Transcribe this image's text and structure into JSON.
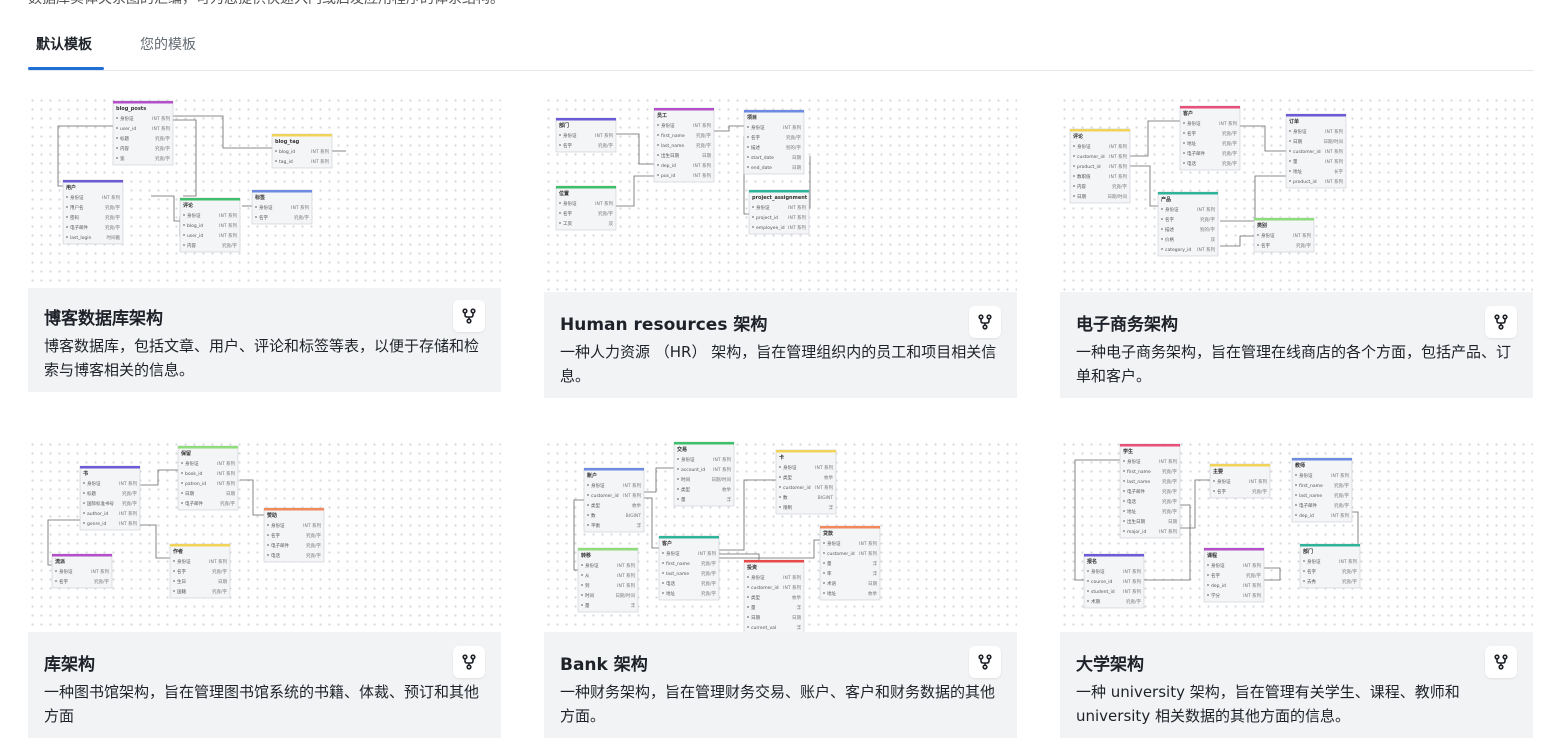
{
  "header": {
    "description": "数据库实体关系图的汇编，可为您提供快速入门或启发应用程序的体系结构。"
  },
  "tabs": [
    {
      "label": "默认模板",
      "active": true
    },
    {
      "label": "您的模板",
      "active": false
    }
  ],
  "templates": [
    {
      "title": "博客数据库架构",
      "description": "博客数据库，包括文章、用户、评论和标签等表，以便于存储和检索与博客相关的信息。",
      "tables": [
        {
          "name": "blog_posts",
          "color": "#b54fc9",
          "rows": [
            [
              "身份证",
              "INT 系列"
            ],
            [
              "user_id",
              "INT 系列"
            ],
            [
              "标题",
              "究竟/字"
            ],
            [
              "内容",
              "究竟/字"
            ],
            [
              "宽",
              "究竟/字"
            ]
          ]
        },
        {
          "name": "blog_tag",
          "color": "#f2d35a",
          "rows": [
            [
              "blog_id",
              "INT 系列"
            ],
            [
              "tag_id",
              "INT 系列"
            ]
          ]
        },
        {
          "name": "用户",
          "color": "#6b5bd6",
          "rows": [
            [
              "身份证",
              "INT 系列"
            ],
            [
              "用户名",
              "究竟/字"
            ],
            [
              "密码",
              "究竟/字"
            ],
            [
              "电子邮件",
              "究竟/字"
            ],
            [
              "last_login",
              "时间戳"
            ]
          ]
        },
        {
          "name": "评论",
          "color": "#3fbf6b",
          "rows": [
            [
              "身份证",
              "INT 系列"
            ],
            [
              "blog_id",
              "INT 系列"
            ],
            [
              "user_id",
              "INT 系列"
            ],
            [
              "内容",
              "究竟/字"
            ]
          ]
        },
        {
          "name": "标签",
          "color": "#6d8be0",
          "rows": [
            [
              "身份证",
              "INT 系列"
            ],
            [
              "名字",
              "究竟/字"
            ]
          ]
        }
      ]
    },
    {
      "title": "Human resources 架构",
      "description": "一种人力资源 （HR） 架构，旨在管理组织内的员工和项目相关信息。",
      "tables": [
        {
          "name": "部门",
          "color": "#6b5bd6",
          "rows": [
            [
              "身份证",
              "INT 系列"
            ],
            [
              "名字",
              "究竟/字"
            ]
          ]
        },
        {
          "name": "员工",
          "color": "#b54fc9",
          "rows": [
            [
              "身份证",
              "INT 系列"
            ],
            [
              "first_name",
              "究竟/字"
            ],
            [
              "last_name",
              "究竟/字"
            ],
            [
              "出生日期",
              "日期"
            ],
            [
              "dep_id",
              "INT 系列"
            ],
            [
              "pos_id",
              "INT 系列"
            ]
          ]
        },
        {
          "name": "项目",
          "color": "#6d8be0",
          "rows": [
            [
              "身份证",
              "INT 系列"
            ],
            [
              "名字",
              "究竟/字"
            ],
            [
              "描述",
              "别的/字"
            ],
            [
              "start_date",
              "日期"
            ],
            [
              "end_date",
              "日期"
            ]
          ]
        },
        {
          "name": "位置",
          "color": "#3fbf6b",
          "rows": [
            [
              "身份证",
              "INT 系列"
            ],
            [
              "名字",
              "究竟/字"
            ],
            [
              "工资",
              "双"
            ]
          ]
        },
        {
          "name": "project_assignment",
          "color": "#2fb39a",
          "rows": [
            [
              "身份证",
              "INT 系列"
            ],
            [
              "project_id",
              "INT 系列"
            ],
            [
              "employee_id",
              "INT 系列"
            ]
          ]
        }
      ]
    },
    {
      "title": "电子商务架构",
      "description": "一种电子商务架构，旨在管理在线商店的各个方面，包括产品、订单和客户。",
      "tables": [
        {
          "name": "评论",
          "color": "#f2d35a",
          "rows": [
            [
              "身份证",
              "INT 系列"
            ],
            [
              "customer_id",
              "INT 系列"
            ],
            [
              "product_id",
              "INT 系列"
            ],
            [
              "数职值",
              "INT 系列"
            ],
            [
              "内容",
              "究竟/字"
            ],
            [
              "日期",
              "日期/时间"
            ]
          ]
        },
        {
          "name": "客户",
          "color": "#e8507a",
          "rows": [
            [
              "身份证",
              "INT 系列"
            ],
            [
              "名字",
              "究竟/字"
            ],
            [
              "地址",
              "究竟/字"
            ],
            [
              "电子邮件",
              "究竟/字"
            ],
            [
              "电话",
              "究竟/字"
            ]
          ]
        },
        {
          "name": "订单",
          "color": "#6b5bd6",
          "rows": [
            [
              "身份证",
              "INT 系列"
            ],
            [
              "日期",
              "日期/时间"
            ],
            [
              "customer_id",
              "INT 系列"
            ],
            [
              "量",
              "INT 系列"
            ],
            [
              "地址",
              "长字"
            ],
            [
              "product_id",
              "INT 系列"
            ]
          ]
        },
        {
          "name": "产品",
          "color": "#2fb39a",
          "rows": [
            [
              "身份证",
              "INT 系列"
            ],
            [
              "名字",
              "究竟/字"
            ],
            [
              "描述",
              "别的/字"
            ],
            [
              "价格",
              "双"
            ],
            [
              "category_id",
              "INT 系列"
            ]
          ]
        },
        {
          "name": "类别",
          "color": "#8fdc7a",
          "rows": [
            [
              "身份证",
              "INT 系列"
            ],
            [
              "名字",
              "究竟/字"
            ]
          ]
        }
      ]
    },
    {
      "title": "库架构",
      "description": "一种图书馆架构，旨在管理图书馆系统的书籍、体裁、预订和其他方面",
      "tables": [
        {
          "name": "书",
          "color": "#6b5bd6",
          "rows": [
            [
              "身份证",
              "INT 系列"
            ],
            [
              "标题",
              "究竟/字"
            ],
            [
              "国际标准书号",
              "究竟/字"
            ],
            [
              "author_id",
              "INT 系列"
            ],
            [
              "genre_id",
              "INT 系列"
            ]
          ]
        },
        {
          "name": "保留",
          "color": "#8fdc7a",
          "rows": [
            [
              "身份证",
              "INT 系列"
            ],
            [
              "book_id",
              "INT 系列"
            ],
            [
              "patron_id",
              "INT 系列"
            ],
            [
              "日期",
              "日期"
            ],
            [
              "电子邮件",
              "究竟/字"
            ]
          ]
        },
        {
          "name": "赞助",
          "color": "#f08a5d",
          "rows": [
            [
              "身份证",
              "INT 系列"
            ],
            [
              "名字",
              "究竟/字"
            ],
            [
              "电子邮件",
              "究竟/字"
            ],
            [
              "电话",
              "究竟/字"
            ]
          ]
        },
        {
          "name": "流派",
          "color": "#b54fc9",
          "rows": [
            [
              "身份证",
              "INT 系列"
            ],
            [
              "名字",
              "究竟/字"
            ]
          ]
        },
        {
          "name": "作者",
          "color": "#f2d35a",
          "rows": [
            [
              "身份证",
              "INT 系列"
            ],
            [
              "名字",
              "究竟/字"
            ],
            [
              "生日",
              "日期"
            ],
            [
              "国籍",
              "究竟/字"
            ]
          ]
        }
      ]
    },
    {
      "title": "Bank 架构",
      "description": "一种财务架构，旨在管理财务交易、账户、客户和财务数据的其他方面。",
      "tables": [
        {
          "name": "账户",
          "color": "#6d8be0",
          "rows": [
            [
              "身份证",
              "INT 系列"
            ],
            [
              "customer_id",
              "INT 系列"
            ],
            [
              "类型",
              "枚举"
            ],
            [
              "数",
              "BIGINT"
            ],
            [
              "平衡",
              "浮"
            ]
          ]
        },
        {
          "name": "交易",
          "color": "#3fbf6b",
          "rows": [
            [
              "身份证",
              "INT 系列"
            ],
            [
              "account_id",
              "INT 系列"
            ],
            [
              "时间",
              "日期/时间"
            ],
            [
              "类型",
              "枚举"
            ],
            [
              "量",
              "浮"
            ]
          ]
        },
        {
          "name": "卡",
          "color": "#f2d35a",
          "rows": [
            [
              "身份证",
              "INT 系列"
            ],
            [
              "类型",
              "枚举"
            ],
            [
              "customer_id",
              "INT 系列"
            ],
            [
              "数",
              "BIGINT"
            ],
            [
              "限制",
              "浮"
            ]
          ]
        },
        {
          "name": "转移",
          "color": "#8fdc7a",
          "rows": [
            [
              "身份证",
              "INT 系列"
            ],
            [
              "从",
              "INT 系列"
            ],
            [
              "到",
              "INT 系列"
            ],
            [
              "时间",
              "日期/时间"
            ],
            [
              "量",
              "浮"
            ]
          ]
        },
        {
          "name": "客户",
          "color": "#2fb39a",
          "rows": [
            [
              "身份证",
              "INT 系列"
            ],
            [
              "first_name",
              "究竟/字"
            ],
            [
              "last_name",
              "究竟/字"
            ],
            [
              "电话",
              "究竟/字"
            ],
            [
              "地址",
              "究竟/字"
            ]
          ]
        },
        {
          "name": "投资",
          "color": "#e84a4a",
          "rows": [
            [
              "身份证",
              "INT 系列"
            ],
            [
              "customer_id",
              "INT 系列"
            ],
            [
              "类型",
              "枚举"
            ],
            [
              "量",
              "浮"
            ],
            [
              "日期",
              "日期"
            ],
            [
              "current_val",
              "浮"
            ]
          ]
        },
        {
          "name": "贷款",
          "color": "#f08a5d",
          "rows": [
            [
              "身份证",
              "INT 系列"
            ],
            [
              "customer_id",
              "INT 系列"
            ],
            [
              "量",
              "浮"
            ],
            [
              "率",
              "浮"
            ],
            [
              "术语",
              "日期"
            ],
            [
              "地址",
              "枚举"
            ]
          ]
        }
      ]
    },
    {
      "title": "大学架构",
      "description": "一种 university 架构，旨在管理有关学生、课程、教师和 university 相关数据的其他方面的信息。",
      "tables": [
        {
          "name": "学生",
          "color": "#e8507a",
          "rows": [
            [
              "身份证",
              "INT 系列"
            ],
            [
              "first_name",
              "究竟/字"
            ],
            [
              "last_name",
              "究竟/字"
            ],
            [
              "电子邮件",
              "究竟/字"
            ],
            [
              "电话",
              "究竟/字"
            ],
            [
              "地址",
              "究竟/字"
            ],
            [
              "出生日期",
              "日期"
            ],
            [
              "major_id",
              "INT 系列"
            ]
          ]
        },
        {
          "name": "主要",
          "color": "#f2d35a",
          "rows": [
            [
              "身份证",
              "INT 系列"
            ],
            [
              "名字",
              "究竟/字"
            ]
          ]
        },
        {
          "name": "教师",
          "color": "#6d8be0",
          "rows": [
            [
              "身份证",
              "INT 系列"
            ],
            [
              "first_name",
              "究竟/字"
            ],
            [
              "last_name",
              "究竟/字"
            ],
            [
              "电子邮件",
              "究竟/字"
            ],
            [
              "dep_id",
              "INT 系列"
            ]
          ]
        },
        {
          "name": "部门",
          "color": "#2fb39a",
          "rows": [
            [
              "身份证",
              "INT 系列"
            ],
            [
              "名字",
              "究竟/字"
            ],
            [
              "去秀",
              "究竟/字"
            ]
          ]
        },
        {
          "name": "课程",
          "color": "#b54fc9",
          "rows": [
            [
              "身份证",
              "INT 系列"
            ],
            [
              "名字",
              "究竟/字"
            ],
            [
              "dep_id",
              "INT 系列"
            ],
            [
              "学分",
              "INT 系列"
            ]
          ]
        },
        {
          "name": "报名",
          "color": "#6b5bd6",
          "rows": [
            [
              "身份证",
              "INT 系列"
            ],
            [
              "course_id",
              "INT 系列"
            ],
            [
              "student_id",
              "INT 系列"
            ],
            [
              "术期",
              "究竟/字"
            ]
          ]
        }
      ]
    }
  ],
  "icons": {
    "fork": "fork-icon",
    "key": "key-icon"
  }
}
